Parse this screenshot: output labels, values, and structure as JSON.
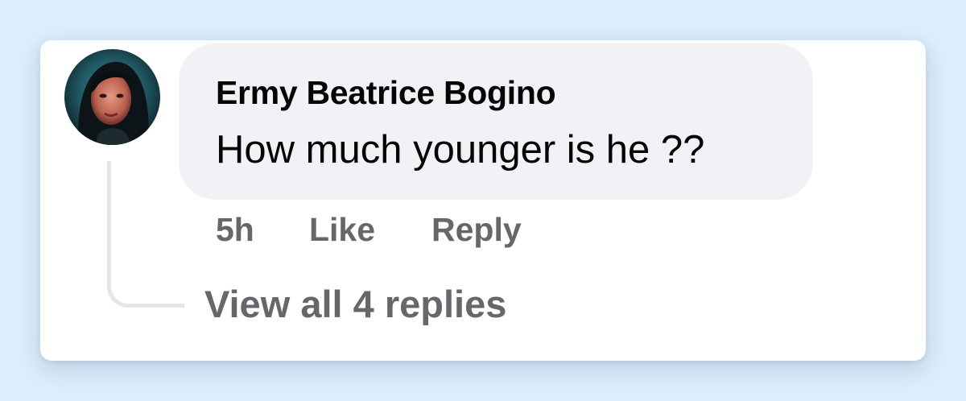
{
  "comment": {
    "author": "Ermy Beatrice Bogino",
    "text": "How much younger is he ??",
    "timestamp": "5h",
    "like_label": "Like",
    "reply_label": "Reply",
    "view_replies_label": "View all 4 replies"
  },
  "colors": {
    "page_background": "#dcedfb",
    "card_background": "#ffffff",
    "bubble_background": "#f0f2f5",
    "primary_text": "#050505",
    "secondary_text": "#65676b",
    "thread_line": "#e4e6eb"
  },
  "icons": {
    "avatar": "profile-photo"
  }
}
